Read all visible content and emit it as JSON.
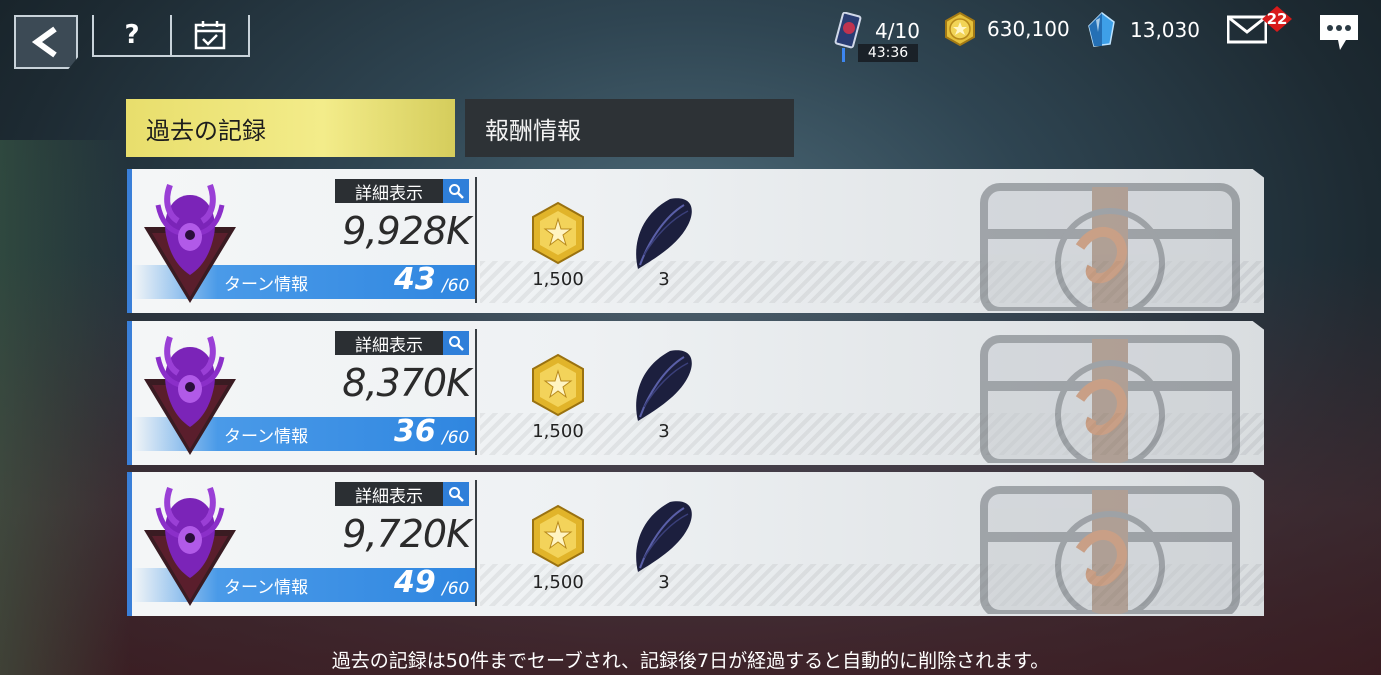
{
  "topbar": {
    "help_label": "?",
    "stamina": {
      "value": "4/10",
      "timer": "43:36"
    },
    "gold": {
      "value": "630,100"
    },
    "gems": {
      "value": "13,030"
    },
    "mail": {
      "badge": "22"
    }
  },
  "tabs": [
    {
      "label": "過去の記録",
      "active": true
    },
    {
      "label": "報酬情報",
      "active": false
    }
  ],
  "records": [
    {
      "detail_label": "詳細表示",
      "score": "9,928K",
      "turn_label": "ターン情報",
      "turn_used": "43",
      "turn_max": "/60",
      "rewards": [
        {
          "icon": "star-medal-icon",
          "qty": "1,500"
        },
        {
          "icon": "dark-feather-icon",
          "qty": "3"
        }
      ]
    },
    {
      "detail_label": "詳細表示",
      "score": "8,370K",
      "turn_label": "ターン情報",
      "turn_used": "36",
      "turn_max": "/60",
      "rewards": [
        {
          "icon": "star-medal-icon",
          "qty": "1,500"
        },
        {
          "icon": "dark-feather-icon",
          "qty": "3"
        }
      ]
    },
    {
      "detail_label": "詳細表示",
      "score": "9,720K",
      "turn_label": "ターン情報",
      "turn_used": "49",
      "turn_max": "/60",
      "rewards": [
        {
          "icon": "star-medal-icon",
          "qty": "1,500"
        },
        {
          "icon": "dark-feather-icon",
          "qty": "3"
        }
      ]
    }
  ],
  "footer": {
    "note": "過去の記録は50件までセーブされ、記録後7日が経過すると自動的に削除されます。"
  },
  "colors": {
    "tab_active": "#e8de6c",
    "turn_bar": "#2f86e0",
    "mail_badge": "#d81b1b",
    "emblem_purple": "#8b2fc9"
  }
}
